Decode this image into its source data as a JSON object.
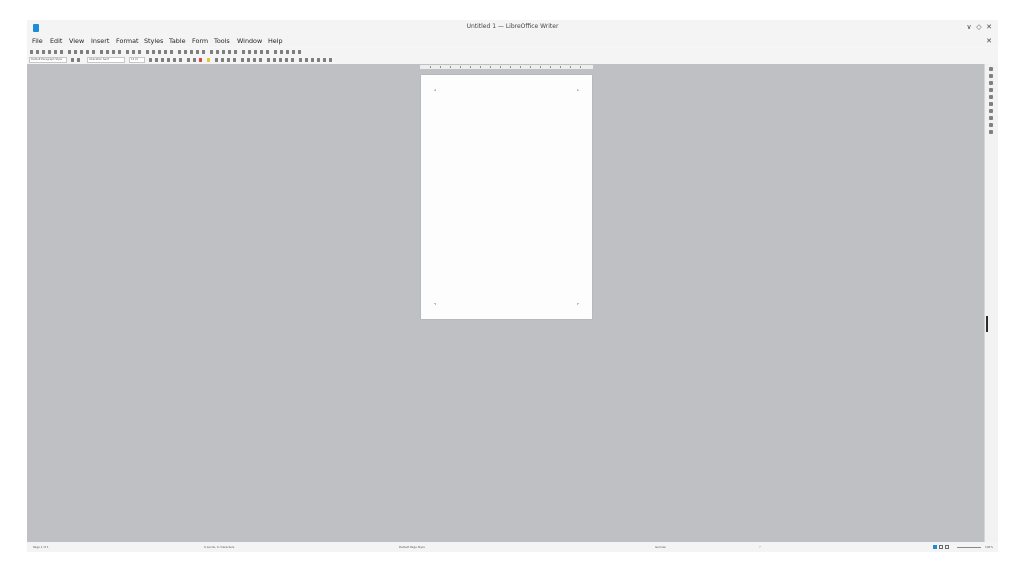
{
  "window": {
    "title": "Untitled 1 — LibreOffice Writer"
  },
  "menu": [
    "File",
    "Edit",
    "View",
    "Insert",
    "Format",
    "Styles",
    "Table",
    "Form",
    "Tools",
    "Window",
    "Help"
  ],
  "formatting": {
    "paragraph_style": "Default Paragraph Style",
    "font_name": "Liberation Serif",
    "font_size": "12 pt"
  },
  "statusbar": {
    "page": "Page 1 of 1",
    "counts": "0 words, 0 characters",
    "page_style": "Default Page Style",
    "language": "German",
    "zoom": "100%"
  },
  "colors": {
    "accent": "#1e8bd6",
    "workspace": "#bec0c4",
    "page": "#fdfdfd"
  }
}
